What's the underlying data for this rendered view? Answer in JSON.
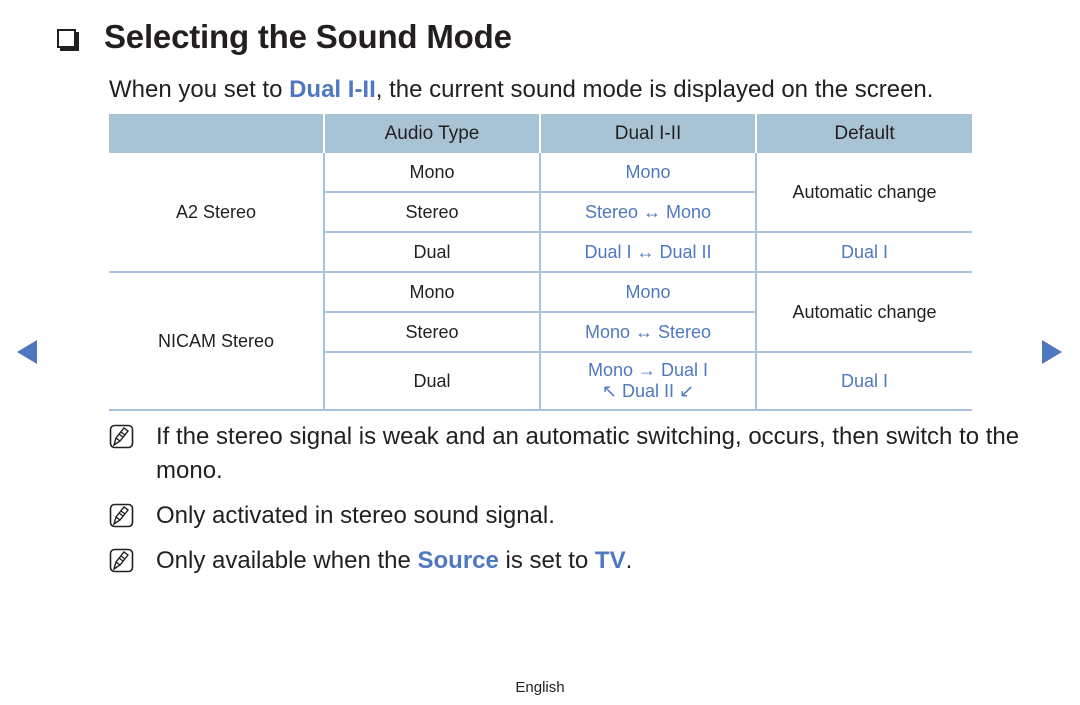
{
  "title": "Selecting the Sound Mode",
  "intro": {
    "prefix": "When you set to ",
    "highlight": "Dual I-II",
    "suffix": ", the current sound mode is displayed on the screen."
  },
  "table": {
    "headers": [
      "",
      "Audio Type",
      "Dual I-II",
      "Default"
    ],
    "groups": [
      {
        "name": "A2 Stereo",
        "rows": [
          {
            "audio_type": "Mono",
            "dual": "Mono"
          },
          {
            "audio_type": "Stereo",
            "dual": "Stereo ↔ Mono"
          },
          {
            "audio_type": "Dual",
            "dual": "Dual I ↔ Dual II"
          }
        ],
        "default_auto": "Automatic change",
        "default_dual": "Dual I"
      },
      {
        "name": "NICAM Stereo",
        "rows": [
          {
            "audio_type": "Mono",
            "dual": "Mono"
          },
          {
            "audio_type": "Stereo",
            "dual": "Mono ↔ Stereo"
          },
          {
            "audio_type": "Dual",
            "dual_line1": "Mono → Dual I",
            "dual_line2": "↖ Dual II ↙"
          }
        ],
        "default_auto": "Automatic change",
        "default_dual": "Dual I"
      }
    ]
  },
  "notes": [
    {
      "text": "If the stereo signal is weak and an automatic switching, occurs, then switch to the mono."
    },
    {
      "text": "Only activated in stereo sound signal."
    },
    {
      "prefix": "Only available when the ",
      "link1": "Source",
      "middle": " is set to ",
      "link2": "TV",
      "suffix": "."
    }
  ],
  "footer": "English",
  "nav": {
    "prev_icon": "prev-page-icon",
    "next_icon": "next-page-icon"
  },
  "colors": {
    "accent": "#4f78c0",
    "header_bg": "#a8c4d4",
    "grid": "#a7c1de",
    "text": "#231f20"
  }
}
